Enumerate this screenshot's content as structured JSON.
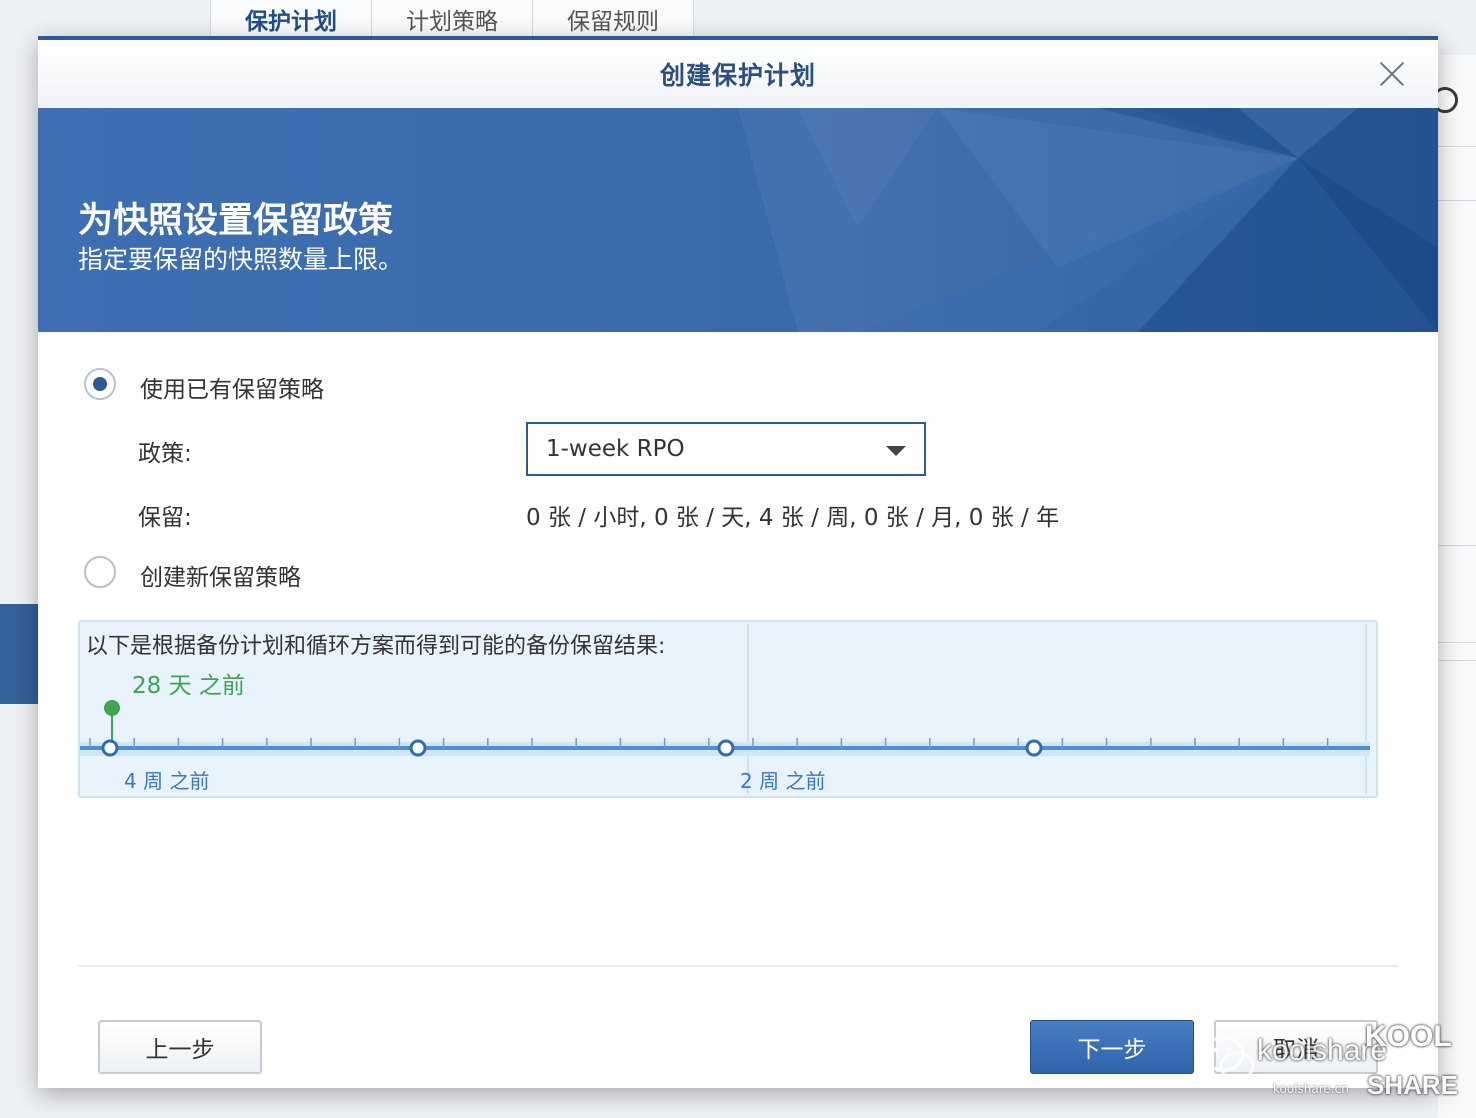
{
  "background": {
    "tabs": [
      "保护计划",
      "计划策略",
      "保留规则"
    ]
  },
  "dialog": {
    "title": "创建保护计划",
    "banner": {
      "heading": "为快照设置保留政策",
      "subheading": "指定要保留的快照数量上限。"
    },
    "options": {
      "use_existing": {
        "label": "使用已有保留策略",
        "checked": true
      },
      "create_new": {
        "label": "创建新保留策略",
        "checked": false
      }
    },
    "policy": {
      "label": "政策:",
      "value": "1-week RPO"
    },
    "retention": {
      "label": "保留:",
      "value": "0 张 / 小时, 0 张 / 天, 4 张 / 周, 0 张 / 月, 0 张 / 年"
    },
    "timeline": {
      "description": "以下是根据备份计划和循环方案而得到可能的备份保留结果:",
      "marker_label": "28 天 之前",
      "tick_labels": [
        "4 周 之前",
        "2 周 之前"
      ],
      "snapshots_kept": 4
    },
    "buttons": {
      "prev": "上一步",
      "next": "下一步",
      "cancel": "取消"
    }
  },
  "watermark": {
    "text": "koolshare",
    "brand_top": "KOOL",
    "brand_bottom": "SHARE",
    "site": "koolshare.cn"
  },
  "colors": {
    "accent": "#2d5a95",
    "banner": "#3566a8",
    "green": "#3da550",
    "timeline_blue": "#3a78c2"
  }
}
